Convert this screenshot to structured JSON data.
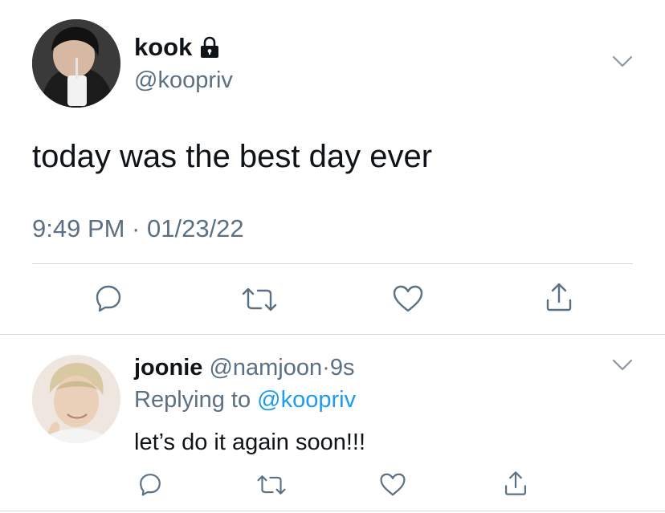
{
  "tweet": {
    "display_name": "kook",
    "handle": "@koopriv",
    "protected_icon": "lock-icon",
    "text": "today was the best day ever",
    "timestamp": "9:49 PM · 01/23/22",
    "actions": [
      "reply-icon",
      "retweet-icon",
      "like-icon",
      "share-icon"
    ]
  },
  "reply": {
    "display_name": "joonie",
    "handle": "@namjoon",
    "separator": "·",
    "age": "9s",
    "replying_prefix": "Replying to",
    "replying_handle": "@koopriv",
    "text": "let’s do it again soon!!!",
    "actions": [
      "reply-icon",
      "retweet-icon",
      "like-icon",
      "share-icon"
    ]
  },
  "colors": {
    "text": "#0f1419",
    "muted": "#5b7083",
    "link": "#1d9bf0",
    "divider": "#cfd9de"
  }
}
